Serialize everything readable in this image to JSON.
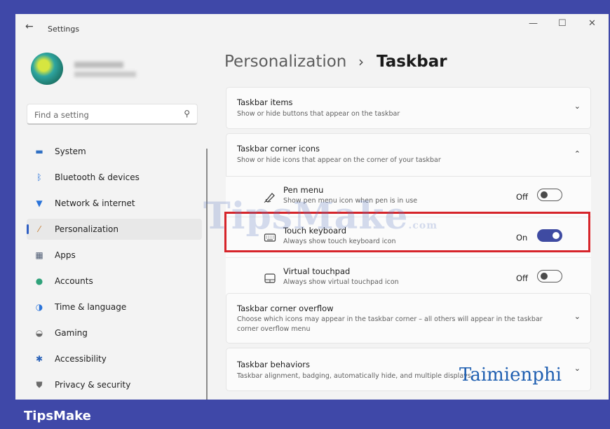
{
  "window": {
    "back_glyph": "←",
    "title": "Settings",
    "minimize": "—",
    "maximize": "☐",
    "close": "✕"
  },
  "search": {
    "placeholder": "Find a setting",
    "icon": "search-icon"
  },
  "nav": [
    {
      "label": "System",
      "icon": "monitor-icon",
      "color": "#2f6fc3",
      "active": false
    },
    {
      "label": "Bluetooth & devices",
      "icon": "bluetooth-icon",
      "color": "#2a73d9",
      "active": false
    },
    {
      "label": "Network & internet",
      "icon": "wifi-icon",
      "color": "#2a73d9",
      "active": false
    },
    {
      "label": "Personalization",
      "icon": "brush-icon",
      "color": "#c67b2e",
      "active": true
    },
    {
      "label": "Apps",
      "icon": "apps-icon",
      "color": "#4e5c73",
      "active": false
    },
    {
      "label": "Accounts",
      "icon": "person-icon",
      "color": "#2fa27a",
      "active": false
    },
    {
      "label": "Time & language",
      "icon": "globe-icon",
      "color": "#2a73d9",
      "active": false
    },
    {
      "label": "Gaming",
      "icon": "controller-icon",
      "color": "#6b6b6b",
      "active": false
    },
    {
      "label": "Accessibility",
      "icon": "accessibility-icon",
      "color": "#2a62b8",
      "active": false
    },
    {
      "label": "Privacy & security",
      "icon": "shield-icon",
      "color": "#6b6b6b",
      "active": false
    }
  ],
  "breadcrumb": {
    "parent": "Personalization",
    "separator": "›",
    "current": "Taskbar"
  },
  "sections": {
    "taskbar_items": {
      "title": "Taskbar items",
      "desc": "Show or hide buttons that appear on the taskbar",
      "chevron": "⌄"
    },
    "corner_icons": {
      "title": "Taskbar corner icons",
      "desc": "Show or hide icons that appear on the corner of your taskbar",
      "chevron": "⌃"
    },
    "corner_overflow": {
      "title": "Taskbar corner overflow",
      "desc": "Choose which icons may appear in the taskbar corner – all others will appear in the taskbar corner overflow menu",
      "chevron": "⌄"
    },
    "behaviors": {
      "title": "Taskbar behaviors",
      "desc": "Taskbar alignment, badging, automatically hide, and multiple displays",
      "chevron": "⌄"
    }
  },
  "corner_items": [
    {
      "title": "Pen menu",
      "desc": "Show pen menu icon when pen is in use",
      "state": "Off",
      "on": false,
      "icon": "pen-icon"
    },
    {
      "title": "Touch keyboard",
      "desc": "Always show touch keyboard icon",
      "state": "On",
      "on": true,
      "icon": "keyboard-icon"
    },
    {
      "title": "Virtual touchpad",
      "desc": "Always show virtual touchpad icon",
      "state": "Off",
      "on": false,
      "icon": "touchpad-icon"
    }
  ],
  "watermarks": {
    "tipsmake": "TipsMake",
    "tipsmake_suffix": ".com",
    "taimienphi": "Taimienphi"
  },
  "banner": {
    "brand": "TipsMake"
  },
  "colors": {
    "accent": "#3f4ba2",
    "highlight": "#d6242a",
    "banner": "#3f48a8"
  }
}
